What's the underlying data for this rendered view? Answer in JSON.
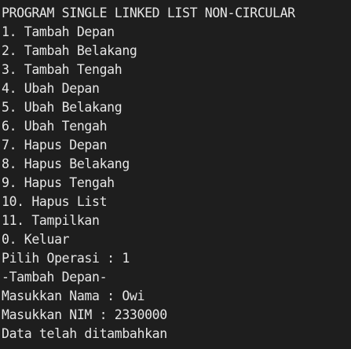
{
  "terminal": {
    "lines": [
      "PROGRAM SINGLE LINKED LIST NON-CIRCULAR",
      "1. Tambah Depan",
      "2. Tambah Belakang",
      "3. Tambah Tengah",
      "4. Ubah Depan",
      "5. Ubah Belakang",
      "6. Ubah Tengah",
      "7. Hapus Depan",
      "8. Hapus Belakang",
      "9. Hapus Tengah",
      "10. Hapus List",
      "11. Tampilkan",
      "0. Keluar",
      "Pilih Operasi : 1",
      "-Tambah Depan-",
      "Masukkan Nama : Owi",
      "Masukkan NIM : 2330000",
      "Data telah ditambahkan"
    ]
  },
  "colors": {
    "background": "#1e1e1e",
    "text": "#e6e6e6"
  }
}
